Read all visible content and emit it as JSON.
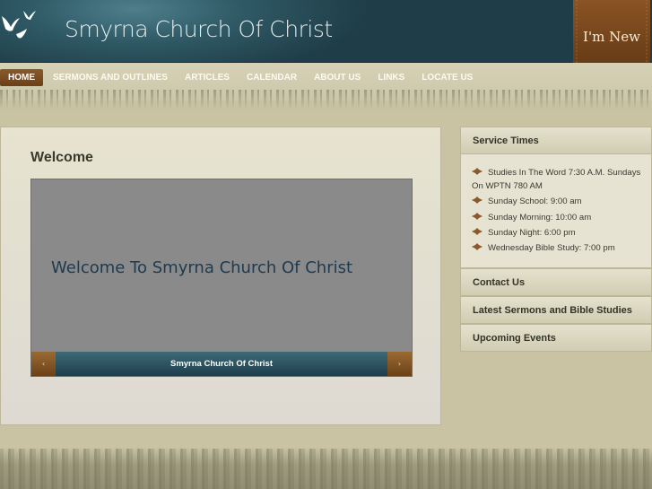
{
  "header": {
    "site_title": "Smyrna Church Of Christ",
    "ribbon_label": "I'm New"
  },
  "nav": {
    "items": [
      {
        "label": "HOME",
        "active": true
      },
      {
        "label": "SERMONS AND OUTLINES"
      },
      {
        "label": "ARTICLES"
      },
      {
        "label": "CALENDAR"
      },
      {
        "label": "ABOUT US"
      },
      {
        "label": "LINKS"
      },
      {
        "label": "LOCATE US"
      }
    ]
  },
  "main": {
    "title": "Welcome",
    "slider": {
      "slide_text": "Welcome To Smyrna Church Of Christ",
      "caption": "Smyrna Church Of Christ",
      "prev_glyph": "‹",
      "next_glyph": "›"
    }
  },
  "sidebar": {
    "service_times": {
      "title": "Service Times",
      "items": [
        "Studies In The Word 7:30 A.M. Sundays On WPTN 780 AM",
        "Sunday School: 9:00 am",
        "Sunday Morning: 10:00 am",
        "Sunday Night: 6:00 pm",
        "Wednesday Bible Study: 7:00 pm"
      ]
    },
    "contact_title": "Contact Us",
    "sermons_title": "Latest Sermons and Bible Studies",
    "events_title": "Upcoming Events"
  },
  "colors": {
    "header_teal": "#2f5a66",
    "accent_brown": "#7a4a20",
    "page_bg": "#c9c3a4"
  },
  "icons": {
    "logo": "doves-icon",
    "bullet": "ornament-icon"
  }
}
